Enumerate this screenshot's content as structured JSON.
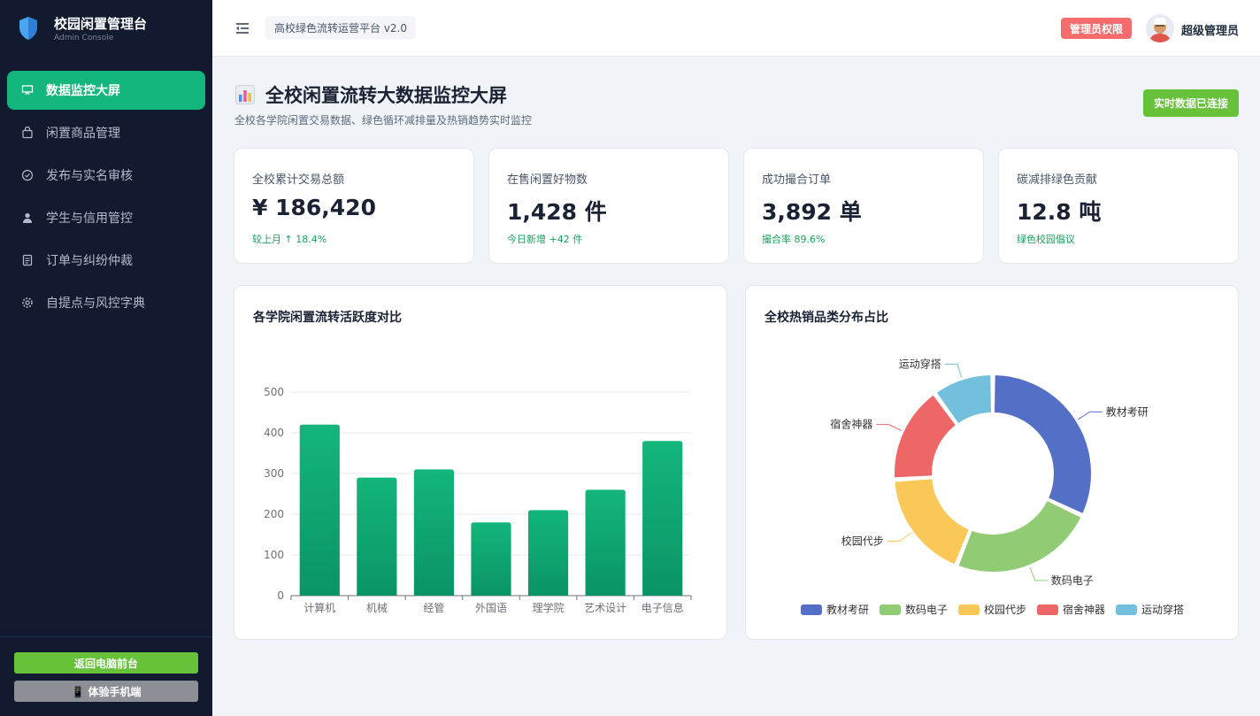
{
  "sidebar": {
    "title": "校园闲置管理台",
    "subtitle": "Admin Console",
    "items": [
      {
        "label": "数据监控大屏",
        "icon": "monitor-icon",
        "active": true
      },
      {
        "label": "闲置商品管理",
        "icon": "bag-icon",
        "active": false
      },
      {
        "label": "发布与实名审核",
        "icon": "check-circle-icon",
        "active": false
      },
      {
        "label": "学生与信用管控",
        "icon": "user-icon",
        "active": false
      },
      {
        "label": "订单与纠纷仲裁",
        "icon": "document-icon",
        "active": false
      },
      {
        "label": "自提点与风控字典",
        "icon": "gear-icon",
        "active": false
      }
    ],
    "btn_front": "返回电脑前台",
    "btn_mobile": "📱 体验手机端"
  },
  "header": {
    "platform": "高校绿色流转运营平台 v2.0",
    "badge": "管理员权限",
    "user": "超级管理员"
  },
  "page": {
    "title": "全校闲置流转大数据监控大屏",
    "subtitle": "全校各学院闲置交易数据、绿色循环减排量及热销趋势实时监控",
    "live_button": "实时数据已连接"
  },
  "stats": [
    {
      "label": "全校累计交易总额",
      "value": "¥ 186,420",
      "note": "较上月 ↑ 18.4%"
    },
    {
      "label": "在售闲置好物数",
      "value": "1,428 件",
      "note": "今日新增 +42 件"
    },
    {
      "label": "成功撮合订单",
      "value": "3,892 单",
      "note": "撮合率 89.6%"
    },
    {
      "label": "碳减排绿色贡献",
      "value": "12.8 吨",
      "note": "绿色校园倡议"
    }
  ],
  "panels": {
    "bar_title": "各学院闲置流转活跃度对比",
    "pie_title": "全校热销品类分布占比"
  },
  "colors": {
    "primary": "#13b67b",
    "success": "#67c23a",
    "danger": "#f56c6c",
    "sidebar": "#111a2e"
  },
  "chart_data": [
    {
      "type": "bar",
      "title": "各学院闲置流转活跃度对比",
      "categories": [
        "计算机",
        "机械",
        "经管",
        "外国语",
        "理学院",
        "艺术设计",
        "电子信息"
      ],
      "values": [
        420,
        290,
        310,
        180,
        210,
        260,
        380
      ],
      "ylim": [
        0,
        500
      ],
      "yticks": [
        0,
        100,
        200,
        300,
        400,
        500
      ],
      "grid": true
    },
    {
      "type": "pie",
      "title": "全校热销品类分布占比",
      "labels": [
        "教材考研",
        "数码电子",
        "校园代步",
        "宿舍神器",
        "运动穿搭"
      ],
      "values": [
        32,
        24,
        18,
        16,
        10
      ],
      "colors": [
        "#5470c6",
        "#91cc75",
        "#fac858",
        "#ee6666",
        "#73c0de"
      ],
      "legend": "bottom"
    }
  ]
}
